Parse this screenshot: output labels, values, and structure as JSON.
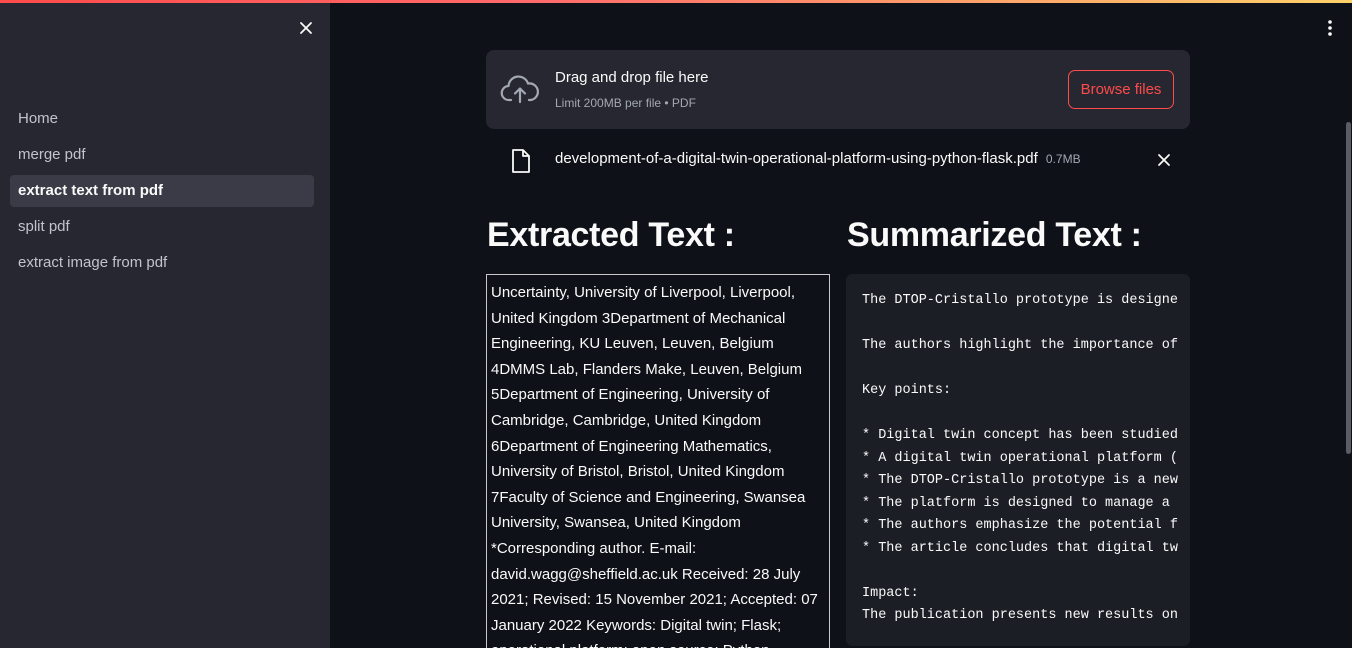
{
  "sidebar": {
    "items": [
      {
        "label": "Home",
        "active": false
      },
      {
        "label": "merge pdf",
        "active": false
      },
      {
        "label": "extract text from pdf",
        "active": true
      },
      {
        "label": "split pdf",
        "active": false
      },
      {
        "label": "extract image from pdf",
        "active": false
      }
    ]
  },
  "uploader": {
    "title": "Drag and drop file here",
    "subtitle": "Limit 200MB per file • PDF",
    "browse_label": "Browse files"
  },
  "file": {
    "name": "development-of-a-digital-twin-operational-platform-using-python-flask.pdf",
    "size": "0.7MB"
  },
  "extracted": {
    "heading": "Extracted Text :",
    "text": "Uncertainty, University of Liverpool, Liverpool, United Kingdom 3Department of Mechanical Engineering, KU Leuven, Leuven, Belgium 4DMMS Lab, Flanders Make, Leuven, Belgium 5Department of Engineering, University of Cambridge, Cambridge, United Kingdom 6Department of Engineering Mathematics, University of Bristol, Bristol, United Kingdom 7Faculty of Science and Engineering, Swansea University, Swansea, United Kingdom *Corresponding author. E-mail: david.wagg@sheffield.ac.uk Received: 28 July 2021; Revised: 15 November 2021; Accepted: 07 January 2022 Keywords: Digital twin; Flask; operational platform; open source; Python"
  },
  "summary": {
    "heading": "Summarized Text :",
    "text": "The DTOP-Cristallo prototype is designe\n\nThe authors highlight the importance of\n\nKey points:\n\n* Digital twin concept has been studied\n* A digital twin operational platform (\n* The DTOP-Cristallo prototype is a new\n* The platform is designed to manage a \n* The authors emphasize the potential f\n* The article concludes that digital tw\n\nImpact:\nThe publication presents new results on"
  },
  "colors": {
    "background": "#0e1117",
    "sidebar": "#262730",
    "accent": "#ff4b4b"
  },
  "icons": {
    "sidebar_close": "close-icon",
    "menu": "vertical-dots-icon",
    "upload": "cloud-upload-icon",
    "file": "file-icon",
    "remove": "close-icon"
  }
}
